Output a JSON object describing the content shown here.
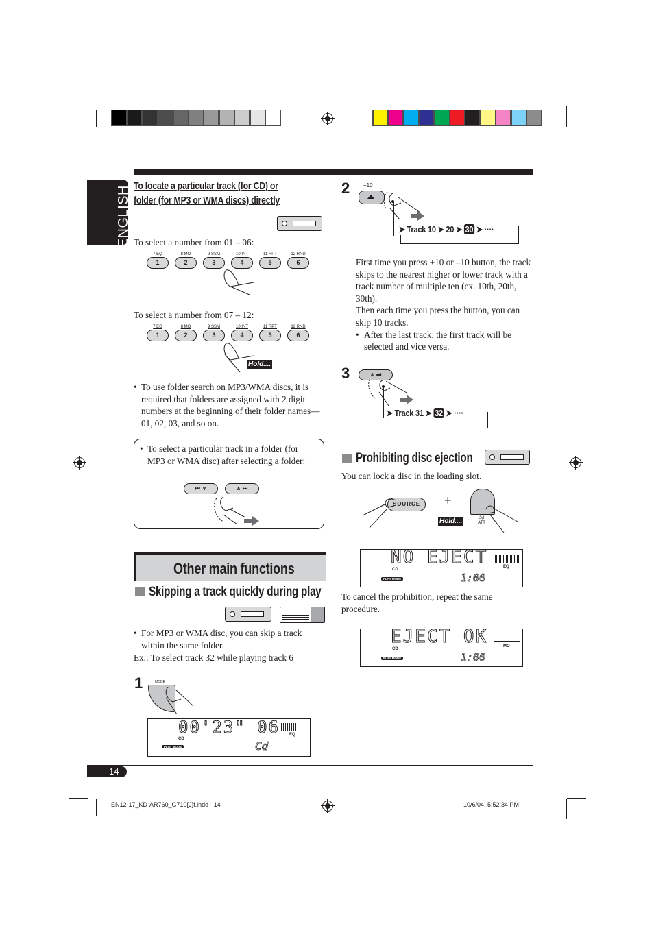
{
  "color_bar": {
    "grayscale": [
      "#000000",
      "#1a1a1a",
      "#333333",
      "#4d4d4d",
      "#666666",
      "#808080",
      "#999999",
      "#b3b3b3",
      "#cccccc",
      "#e6e6e6",
      "#ffffff"
    ],
    "colors": [
      "#fff200",
      "#ec008c",
      "#00aeef",
      "#2e3192",
      "#00a651",
      "#ed1c24",
      "#231f20",
      "#fff685",
      "#f484c4",
      "#7dd3f7",
      "#8c8c8c"
    ]
  },
  "side_tab": {
    "label": "ENGLISH"
  },
  "locate_section": {
    "heading_line1": "To locate a particular track (for CD) or",
    "heading_line2": "folder (for MP3 or WMA discs) directly",
    "select_01_06": "To select a number from 01 – 06:",
    "select_07_12": "To select a number from 07 – 12:",
    "buttons": [
      {
        "number": "1",
        "label": "7  EQ"
      },
      {
        "number": "2",
        "label": "8  MO"
      },
      {
        "number": "3",
        "label": "9 SSM"
      },
      {
        "number": "4",
        "label": "10 INT"
      },
      {
        "number": "5",
        "label": "11 RPT"
      },
      {
        "number": "6",
        "label": "12 RND"
      }
    ],
    "hold_label": "Hold....",
    "bullet_folder_search": "To use folder search on MP3/WMA discs, it is required that folders are assigned with 2 digit numbers at the beginning of their folder names—01, 02, 03, and so on.",
    "note_box_text": "To select a particular track in a folder (for MP3 or WMA disc) after selecting a folder:",
    "note_prev_button": "⏮ ∨",
    "note_next_button": "∧ ⏭"
  },
  "other_functions": {
    "title": "Other main functions",
    "skip_heading": "Skipping a track quickly during play",
    "bullet_mp3": "For MP3 or WMA disc, you can skip a track within the same folder.",
    "example": "Ex.: To select track 32 while playing track 6",
    "step1": {
      "number": "1",
      "button_label": "MODE",
      "lcd_main": "00'23\" 06",
      "lcd_source": "CD",
      "lcd_bottom": "Cd",
      "lcd_playmode": "PLAY MODE",
      "lcd_eq": "EQ"
    },
    "step2": {
      "number": "2",
      "button_label": "+10",
      "sequence": [
        "Track 10",
        "20",
        "30",
        "····"
      ],
      "highlight": "30",
      "description": "First time you press +10 or –10 button, the track skips to the nearest higher or lower track with a track number of multiple ten (ex. 10th, 20th, 30th).",
      "description2": "Then each time you press the button, you can skip 10 tracks.",
      "bullet": "After the last track, the first track will be selected and vice versa."
    },
    "step3": {
      "number": "3",
      "button_label": "∧ ⏭",
      "sequence": [
        "Track 31",
        "32",
        "····"
      ],
      "highlight": "32"
    }
  },
  "prohibit_section": {
    "heading": "Prohibiting disc ejection",
    "intro": "You can lock a disc in the loading slot.",
    "source_button": "SOURCE",
    "plus": "+",
    "hold_label": "Hold....",
    "power_label_line1": "⏻/I",
    "power_label_line2": "ATT",
    "lcd1_text": "NO EJECT",
    "lcd1_source": "CD",
    "lcd1_time": "1:00",
    "lcd1_eq": "EQ",
    "cancel_text": "To cancel the prohibition, repeat the same procedure.",
    "lcd2_text": "EJECT OK",
    "lcd2_source": "CD",
    "lcd2_time": "1:00",
    "lcd2_eq": "MO",
    "playmode": "PLAY MODE"
  },
  "footer": {
    "page_number": "14",
    "file_name": "EN12-17_KD-AR760_G710[J]f.indd   14",
    "timestamp": "10/6/04, 5:52:34 PM"
  }
}
